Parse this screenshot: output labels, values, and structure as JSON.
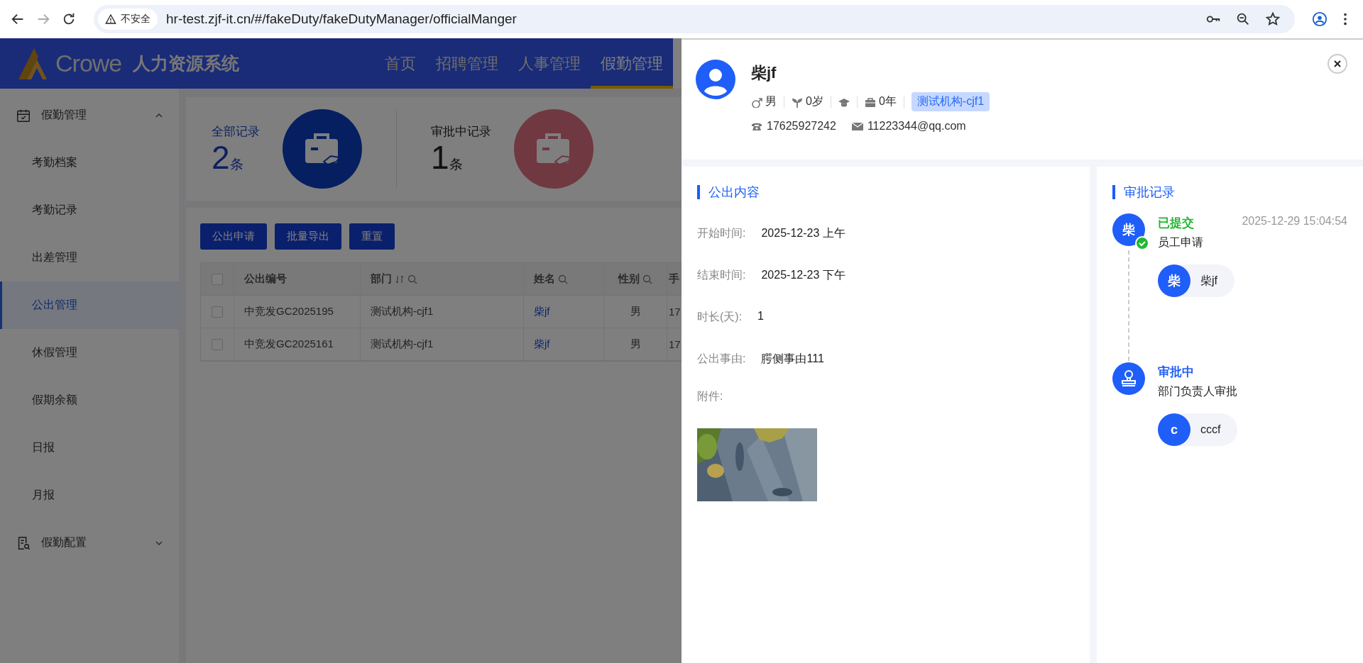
{
  "browser": {
    "security_label": "不安全",
    "url": "hr-test.zjf-it.cn/#/fakeDuty/fakeDutyManager/officialManger"
  },
  "app": {
    "brand": "Crowe",
    "title": "人力资源系统",
    "nav": [
      {
        "label": "首页",
        "selected": false
      },
      {
        "label": "招聘管理",
        "selected": false
      },
      {
        "label": "人事管理",
        "selected": false
      },
      {
        "label": "假勤管理",
        "selected": true
      }
    ]
  },
  "sidebar": {
    "groups": [
      {
        "label": "假勤管理",
        "kind": "calendar",
        "expanded": true,
        "children": [
          {
            "label": "考勤档案",
            "selected": false
          },
          {
            "label": "考勤记录",
            "selected": false
          },
          {
            "label": "出差管理",
            "selected": false
          },
          {
            "label": "公出管理",
            "selected": true
          },
          {
            "label": "休假管理",
            "selected": false
          },
          {
            "label": "假期余额",
            "selected": false
          },
          {
            "label": "日报",
            "selected": false
          },
          {
            "label": "月报",
            "selected": false
          }
        ]
      },
      {
        "label": "假勤配置",
        "kind": "document",
        "expanded": false
      }
    ]
  },
  "stats": [
    {
      "kind": "total",
      "label": "全部记录",
      "count": "2",
      "unit": "条"
    },
    {
      "kind": "pending",
      "label": "审批中记录",
      "count": "1",
      "unit": "条"
    }
  ],
  "toolbar": {
    "buttons": [
      "公出申请",
      "批量导出",
      "重置"
    ]
  },
  "table": {
    "all_checked": false,
    "columns": [
      {
        "label": "公出编号",
        "sortable": false,
        "filterable": false
      },
      {
        "label": "部门",
        "sortable": true,
        "filterable": true
      },
      {
        "label": "姓名",
        "sortable": false,
        "filterable": true
      },
      {
        "label": "性别",
        "sortable": false,
        "filterable": true
      },
      {
        "label": "手",
        "sortable": false,
        "filterable": false
      }
    ],
    "rows": [
      {
        "checked": false,
        "cells": [
          "中竞发GC2025195",
          "测试机构-cjf1",
          "柴jf",
          "男",
          "17"
        ]
      },
      {
        "checked": false,
        "cells": [
          "中竞发GC2025161",
          "测试机构-cjf1",
          "柴jf",
          "男",
          "17"
        ]
      }
    ]
  },
  "drawer": {
    "profile": {
      "name": "柴jf",
      "info": [
        {
          "kind": "gender",
          "text": "男"
        },
        {
          "kind": "age",
          "text": "0岁"
        },
        {
          "kind": "education"
        },
        {
          "kind": "work_years",
          "text": "0年"
        }
      ],
      "org": "测试机构-cjf1",
      "phone": "17625927242",
      "email": "11223344@qq.com"
    },
    "content": {
      "title": "公出内容",
      "fields": [
        {
          "label": "开始时间:",
          "value": "2025-12-23 上午"
        },
        {
          "label": "结束时间:",
          "value": "2025-12-23 下午"
        },
        {
          "label": "时长(天):",
          "value": "1"
        },
        {
          "label": "公出事由:",
          "value": "腭侧事由111"
        }
      ],
      "attachment_label": "附件:"
    },
    "approval": {
      "title": "审批记录",
      "steps": [
        {
          "status": "已提交",
          "kind": "done",
          "time": "2025-12-29 15:04:54",
          "desc": "员工申请",
          "avatar": {
            "kind": "initial",
            "text": "柴"
          },
          "completed": true,
          "person": {
            "initial": "柴",
            "name": "柴jf"
          }
        },
        {
          "status": "审批中",
          "kind": "pending",
          "desc": "部门负责人审批",
          "avatar": {
            "kind": "stamp"
          },
          "completed": false,
          "person": {
            "initial": "c",
            "name": "cccf"
          }
        }
      ]
    }
  }
}
